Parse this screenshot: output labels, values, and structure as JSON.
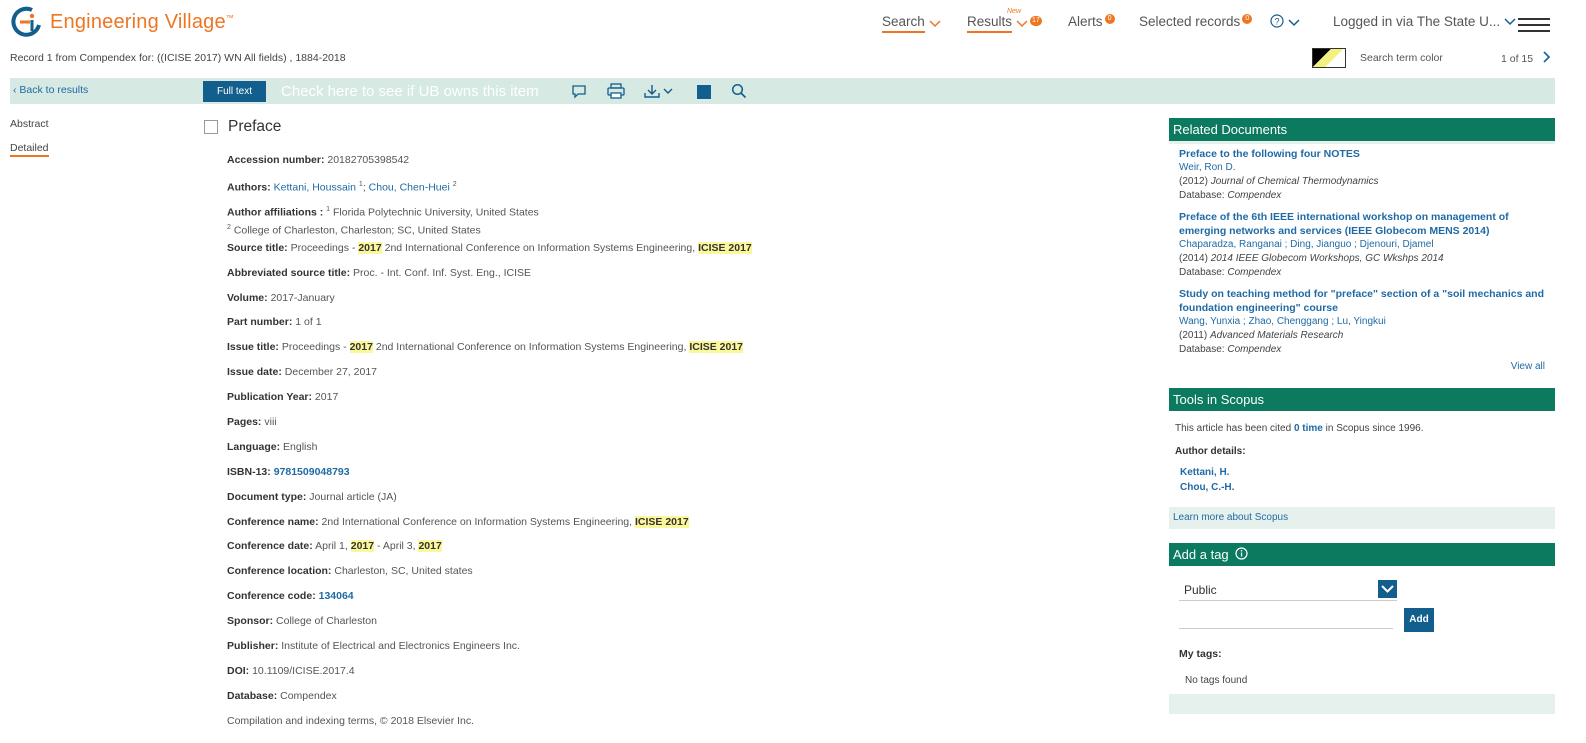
{
  "header": {
    "logo_text": "Engineering Village",
    "logo_tm": "™",
    "nav": {
      "search": "Search",
      "results": "Results",
      "results_new": "New",
      "results_count": "17",
      "alerts": "Alerts",
      "alerts_count": "0",
      "selected": "Selected records",
      "selected_count": "0",
      "login": "Logged in via The State U..."
    },
    "record_info": "Record 1 from Compendex for: ((ICISE 2017) WN All fields) , 1884-2018",
    "search_term_color": "Search term color",
    "pager": "1 of 15"
  },
  "toolbar": {
    "back": "Back to results",
    "full_text": "Full text",
    "ub_link": "Check here to see if UB owns this item"
  },
  "side_nav": {
    "abstract": "Abstract",
    "detailed": "Detailed"
  },
  "document": {
    "title": "Preface",
    "accession_label": "Accession number:",
    "accession": "20182705398542",
    "authors_label": "Authors:",
    "author1": "Kettani, Houssain",
    "author1_sup": "1",
    "author_sep": ";",
    "author2": "Chou, Chen-Huei",
    "author2_sup": "2",
    "affil_label": "Author affiliations :",
    "affil1_sup": "1",
    "affil1": "Florida Polytechnic University, United States",
    "affil2_sup": "2",
    "affil2": "College of Charleston, Charleston; SC, United States",
    "source_label": "Source title:",
    "source_pre": "Proceedings -",
    "source_hl1": "2017",
    "source_mid": "2nd International Conference on Information Systems Engineering,",
    "source_hl2": "ICISE 2017",
    "abbrev_label": "Abbreviated source title:",
    "abbrev": "Proc. - Int. Conf. Inf. Syst. Eng., ICISE",
    "volume_label": "Volume:",
    "volume": "2017-January",
    "part_label": "Part number:",
    "part": "1 of 1",
    "issue_title_label": "Issue title:",
    "issue_pre": "Proceedings -",
    "issue_hl1": "2017",
    "issue_mid": "2nd International Conference on Information Systems Engineering,",
    "issue_hl2": "ICISE 2017",
    "issue_date_label": "Issue date:",
    "issue_date": "December 27, 2017",
    "pub_year_label": "Publication Year:",
    "pub_year": "2017",
    "pages_label": "Pages:",
    "pages": "viii",
    "language_label": "Language:",
    "language": "English",
    "isbn_label": "ISBN-13:",
    "isbn": "9781509048793",
    "doctype_label": "Document type:",
    "doctype": "Journal article (JA)",
    "conf_name_label": "Conference name:",
    "conf_name": "2nd International Conference on Information Systems Engineering,",
    "conf_name_hl": "ICISE 2017",
    "conf_date_label": "Conference date:",
    "conf_date_a": "April 1,",
    "conf_date_hl1": "2017",
    "conf_date_b": "- April 3,",
    "conf_date_hl2": "2017",
    "conf_loc_label": "Conference location:",
    "conf_loc": "Charleston, SC, United states",
    "conf_code_label": "Conference code:",
    "conf_code": "134064",
    "sponsor_label": "Sponsor:",
    "sponsor": "College of Charleston",
    "publisher_label": "Publisher:",
    "publisher": "Institute of Electrical and Electronics Engineers Inc.",
    "doi_label": "DOI:",
    "doi": "10.1109/ICISE.2017.4",
    "database_label": "Database:",
    "database": "Compendex",
    "copyright": "Compilation and indexing terms, © 2018 Elsevier Inc."
  },
  "related": {
    "header": "Related Documents",
    "items": [
      {
        "title": "Preface to the following four NOTES",
        "authors": "Weir, Ron D.",
        "year": "(2012)",
        "journal": "Journal of Chemical Thermodynamics",
        "db_label": "Database:",
        "db": "Compendex"
      },
      {
        "title": "Preface of the 6th IEEE international workshop on management of emerging networks and services (IEEE Globecom MENS 2014)",
        "authors": "Chaparadza, Ranganai ; Ding, Jianguo ; Djenouri, Djamel",
        "year": "(2014)",
        "journal": "2014 IEEE Globecom Workshops, GC Wkshps 2014",
        "db_label": "Database:",
        "db": "Compendex"
      },
      {
        "title": "Study on teaching method for \"preface\" section of a \"soil mechanics and foundation engineering\" course",
        "authors": "Wang, Yunxia ; Zhao, Chenggang ; Lu, Yingkui",
        "year": "(2011)",
        "journal": "Advanced Materials Research",
        "db_label": "Database:",
        "db": "Compendex"
      }
    ],
    "view_all": "View all"
  },
  "scopus": {
    "header": "Tools in Scopus",
    "cited_pre": "This article has been cited",
    "cited_link": "0 time",
    "cited_post": "in Scopus since 1996.",
    "author_details": "Author details:",
    "author1": "Kettani, H.",
    "author2": "Chou, C.-H.",
    "learn_more": "Learn more about Scopus"
  },
  "tags": {
    "header": "Add a tag",
    "select_value": "Public",
    "add_button": "Add",
    "my_tags": "My tags:",
    "no_tags": "No tags found"
  },
  "colors": {
    "accent_orange": "#ee7623",
    "teal_header": "#0b7a5f",
    "toolbar_bg": "#d6e9e2",
    "button_blue": "#125e8c",
    "link_blue": "#1f6aa5",
    "highlight": "#fbf89b"
  }
}
